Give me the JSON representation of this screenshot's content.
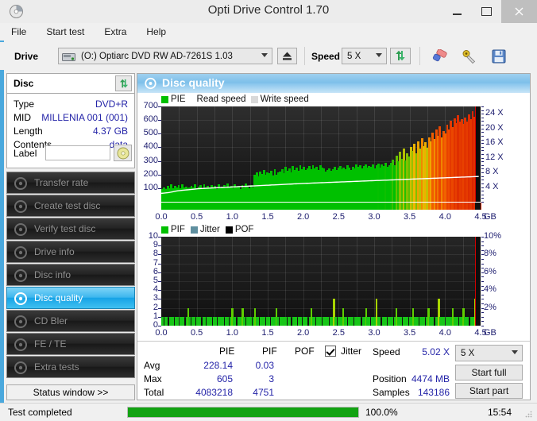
{
  "window": {
    "title": "Opti Drive Control 1.70",
    "icon": "disc-icon",
    "minimize": "–",
    "maximize": "□",
    "close": "×"
  },
  "menu": {
    "items": [
      "File",
      "Start test",
      "Extra",
      "Help"
    ]
  },
  "toolbar": {
    "drive_label": "Drive",
    "drive_value": "(O:)   Optiarc DVD RW AD-7261S 1.03",
    "eject_icon": "eject-icon",
    "speed_label": "Speed",
    "speed_value": "5 X",
    "refresh_icon": "refresh-icon",
    "erase_icon": "eraser-icon",
    "tools_icon": "tools-icon",
    "save_icon": "save-icon"
  },
  "disc_panel": {
    "title": "Disc",
    "refresh_icon": "refresh-icon",
    "rows": [
      {
        "label": "Type",
        "value": "DVD+R"
      },
      {
        "label": "MID",
        "value": "MILLENIA 001 (001)"
      },
      {
        "label": "Length",
        "value": "4.37 GB"
      },
      {
        "label": "Contents",
        "value": "data"
      }
    ],
    "label_field_label": "Label",
    "label_field_value": "",
    "label_field_placeholder": "",
    "cd_icon": "cd-icon"
  },
  "nav": {
    "items": [
      {
        "label": "Transfer rate",
        "icon": "disc-icon",
        "selected": false
      },
      {
        "label": "Create test disc",
        "icon": "disc-icon",
        "selected": false
      },
      {
        "label": "Verify test disc",
        "icon": "disc-icon",
        "selected": false
      },
      {
        "label": "Drive info",
        "icon": "disc-icon",
        "selected": false
      },
      {
        "label": "Disc info",
        "icon": "disc-icon",
        "selected": false
      },
      {
        "label": "Disc quality",
        "icon": "disc-icon",
        "selected": true
      },
      {
        "label": "CD Bler",
        "icon": "disc-icon",
        "selected": false
      },
      {
        "label": "FE / TE",
        "icon": "disc-icon",
        "selected": false
      },
      {
        "label": "Extra tests",
        "icon": "disc-icon",
        "selected": false
      }
    ],
    "status_window_button": "Status window >>"
  },
  "panel": {
    "title": "Disc quality",
    "icon": "disc-icon"
  },
  "chart_data": [
    {
      "type": "bar",
      "name": "pie-chart",
      "title": "",
      "legend": [
        {
          "label": "PIE",
          "color": "#00c000",
          "swatch": true
        },
        {
          "label": "Read speed",
          "color": "#ffffff",
          "swatch": false
        },
        {
          "label": "Write speed",
          "color": "#d9d9d9",
          "swatch": true
        }
      ],
      "legend_position": "top-left",
      "xlabel": "GB",
      "ylabel": "",
      "xlim": [
        0.0,
        4.5
      ],
      "ylim": [
        0,
        700
      ],
      "xticks": [
        "0.0",
        "0.5",
        "1.0",
        "1.5",
        "2.0",
        "2.5",
        "3.0",
        "3.5",
        "4.0",
        "4.5"
      ],
      "xunit": "GB",
      "yticks": [
        700,
        600,
        500,
        400,
        300,
        200,
        100
      ],
      "y2ticks": [
        "24 X",
        "20 X",
        "16 X",
        "12 X",
        "8 X",
        "4 X"
      ],
      "y2lim": [
        0,
        26
      ],
      "grid": true,
      "series": [
        {
          "name": "PIE",
          "values": [
            95,
            108,
            96,
            118,
            102,
            126,
            99,
            114,
            105,
            121,
            97,
            131,
            104,
            112,
            99,
            108,
            119,
            103,
            126,
            97,
            110,
            122,
            101,
            129,
            106,
            114,
            98,
            123,
            107,
            118,
            96,
            128,
            103,
            112,
            121,
            99,
            135,
            106,
            114,
            101,
            127,
            110,
            118,
            96,
            124,
            105,
            133,
            112,
            99,
            120,
            108,
            196,
            215,
            188,
            222,
            205,
            231,
            198,
            214,
            209,
            226,
            192,
            238,
            201,
            218,
            224,
            241,
            212,
            256,
            229,
            245,
            218,
            262,
            234,
            251,
            226,
            268,
            241,
            256,
            232,
            248,
            265,
            239,
            271,
            246,
            259,
            233,
            268,
            252,
            244,
            219,
            235,
            248,
            226,
            241,
            258,
            232,
            249,
            264,
            238,
            253,
            242,
            267,
            251,
            236,
            259,
            245,
            272,
            254,
            268,
            243,
            261,
            276,
            249,
            265,
            258,
            274,
            246,
            269,
            283,
            251,
            277,
            262,
            288,
            254,
            271,
            285,
            312,
            268,
            341,
            296,
            365,
            318,
            389,
            302,
            358,
            334,
            402,
            371,
            428,
            356,
            445,
            392,
            468,
            411,
            435,
            398,
            472,
            441,
            508,
            462,
            531,
            486,
            554,
            472,
            518,
            503,
            568,
            532,
            596,
            551,
            612,
            578,
            634,
            592,
            605,
            571,
            618,
            589,
            641,
            607,
            663,
            625,
            598,
            647,
            672
          ]
        },
        {
          "name": "Read speed",
          "values": [
            2.3,
            2.35,
            2.4,
            2.45,
            2.5,
            2.6,
            2.7,
            2.8,
            2.9,
            3.0,
            3.05,
            3.1,
            3.15,
            3.2,
            3.25,
            3.3,
            3.35,
            3.4,
            3.45,
            3.5,
            3.55,
            3.6,
            3.62,
            3.65,
            3.68,
            3.7,
            3.72,
            3.75,
            3.78,
            3.8,
            3.82,
            3.85,
            3.88,
            3.9,
            3.92,
            3.95,
            3.98,
            4.0,
            4.02,
            4.05,
            4.08,
            4.1,
            4.12,
            4.15,
            4.18,
            4.2,
            4.22,
            4.25,
            4.28,
            4.3,
            4.32,
            4.35,
            4.38,
            4.4,
            4.42,
            4.45,
            4.48,
            4.5,
            4.52,
            4.55,
            4.58,
            4.6,
            4.62,
            4.65,
            4.68,
            4.7,
            4.72,
            4.75,
            4.78,
            4.8,
            4.82,
            4.85,
            4.88,
            4.9,
            4.92,
            4.95,
            4.98,
            5.0,
            5.02,
            5.04,
            5.06,
            5.08,
            5.1,
            5.12,
            5.14,
            5.16,
            5.18,
            5.2,
            5.22,
            5.24,
            5.26,
            5.28,
            5.3,
            5.32,
            5.34,
            5.36,
            5.38,
            5.4,
            5.42,
            5.44,
            5.46,
            5.48,
            5.5,
            5.52,
            5.54,
            5.56,
            5.58,
            5.6,
            5.62,
            5.64,
            5.66,
            5.68,
            5.7,
            5.72,
            5.74,
            5.76,
            5.78,
            5.8,
            5.82,
            5.84,
            5.86,
            5.88,
            5.9,
            5.92,
            5.94,
            5.96,
            5.98,
            6.0,
            6.02,
            6.04,
            6.06,
            6.08,
            6.1,
            6.12,
            6.14,
            6.16,
            6.18,
            6.2,
            6.22,
            6.24,
            6.26,
            6.28,
            6.3,
            6.32,
            6.34,
            6.36,
            6.38,
            6.4,
            6.42,
            6.44,
            6.46,
            6.48,
            6.5,
            6.52,
            6.54,
            6.56,
            6.58,
            6.6,
            6.62,
            6.64,
            6.66,
            6.68,
            6.7,
            6.72,
            6.74,
            6.76,
            6.78,
            6.8,
            6.82,
            6.84,
            6.86,
            6.88,
            6.9
          ]
        }
      ],
      "severity_thresholds": {
        "green_max": 280,
        "yellow_max": 420,
        "orange_max": 520
      }
    },
    {
      "type": "bar",
      "name": "pif-chart",
      "title": "",
      "legend": [
        {
          "label": "PIF",
          "color": "#00c000",
          "swatch": true
        },
        {
          "label": "Jitter",
          "color": "#5f8f9f",
          "swatch": true
        },
        {
          "label": "POF",
          "color": "#000000",
          "swatch": true
        }
      ],
      "legend_position": "top-left",
      "xlabel": "GB",
      "ylabel": "",
      "xlim": [
        0.0,
        4.5
      ],
      "ylim": [
        0,
        10
      ],
      "xticks": [
        "0.0",
        "0.5",
        "1.0",
        "1.5",
        "2.0",
        "2.5",
        "3.0",
        "3.5",
        "4.0",
        "4.5"
      ],
      "xunit": "GB",
      "yticks": [
        10,
        9,
        8,
        7,
        6,
        5,
        4,
        3,
        2,
        1,
        0
      ],
      "y2ticks": [
        "10%",
        "8%",
        "6%",
        "4%",
        "2%"
      ],
      "y2lim": [
        0,
        10
      ],
      "grid": true,
      "series": [
        {
          "name": "PIF",
          "values": [
            1,
            0,
            1,
            1,
            0,
            1,
            1,
            1,
            0,
            1,
            1,
            0,
            1,
            1,
            1,
            0,
            1,
            2,
            1,
            0,
            1,
            1,
            0,
            1,
            1,
            1,
            0,
            1,
            1,
            0,
            1,
            1,
            1,
            0,
            1,
            1,
            0,
            1,
            1,
            1,
            1,
            0,
            1,
            1,
            0,
            1,
            2,
            1,
            1,
            0,
            1,
            1,
            1,
            2,
            1,
            0,
            1,
            1,
            1,
            0,
            1,
            2,
            1,
            1,
            0,
            1,
            1,
            1,
            0,
            1,
            1,
            0,
            1,
            1,
            1,
            2,
            1,
            0,
            1,
            1,
            1,
            1,
            0,
            1,
            1,
            0,
            1,
            1,
            1,
            0,
            1,
            1,
            0,
            1,
            1,
            1,
            0,
            1,
            2,
            1,
            1,
            0,
            1,
            1,
            1,
            0,
            1,
            1,
            1,
            1,
            0,
            1,
            1,
            3,
            1,
            0,
            1,
            1,
            1,
            2,
            1,
            1,
            0,
            1,
            1,
            1,
            0,
            1,
            1,
            1,
            1,
            0,
            1,
            1,
            2,
            1,
            1,
            0,
            1,
            1,
            1,
            3,
            1,
            1,
            0,
            1,
            1,
            1,
            0,
            1,
            1,
            1,
            0,
            1,
            2,
            1,
            1,
            1,
            0,
            1,
            1,
            1,
            0,
            1,
            1,
            2,
            1,
            1,
            1,
            0,
            1,
            1,
            1,
            0,
            1,
            2,
            1,
            1,
            1,
            0,
            1,
            1,
            3,
            1,
            1,
            1,
            0,
            1,
            1,
            1,
            1,
            2,
            1,
            1,
            1,
            0,
            1,
            1,
            2,
            1,
            1,
            1,
            0,
            1,
            1,
            1,
            3,
            2,
            1,
            1
          ]
        }
      ]
    }
  ],
  "stats": {
    "columns": [
      "PIE",
      "PIF",
      "POF"
    ],
    "jitter_checkbox_checked": true,
    "jitter_label": "Jitter",
    "rows": [
      {
        "label": "Avg",
        "pie": "228.14",
        "pif": "0.03",
        "pof": ""
      },
      {
        "label": "Max",
        "pie": "605",
        "pif": "3",
        "pof": ""
      },
      {
        "label": "Total",
        "pie": "4083218",
        "pif": "4751",
        "pof": ""
      }
    ],
    "speed_label": "Speed",
    "speed_value": "5.02 X",
    "position_label": "Position",
    "position_value": "4474 MB",
    "samples_label": "Samples",
    "samples_value": "143186",
    "speed_select_value": "5 X",
    "start_full_button": "Start full",
    "start_part_button": "Start part"
  },
  "statusbar": {
    "message": "Test completed",
    "progress_percent": "100.0%",
    "progress_value": 100,
    "time": "15:54"
  }
}
